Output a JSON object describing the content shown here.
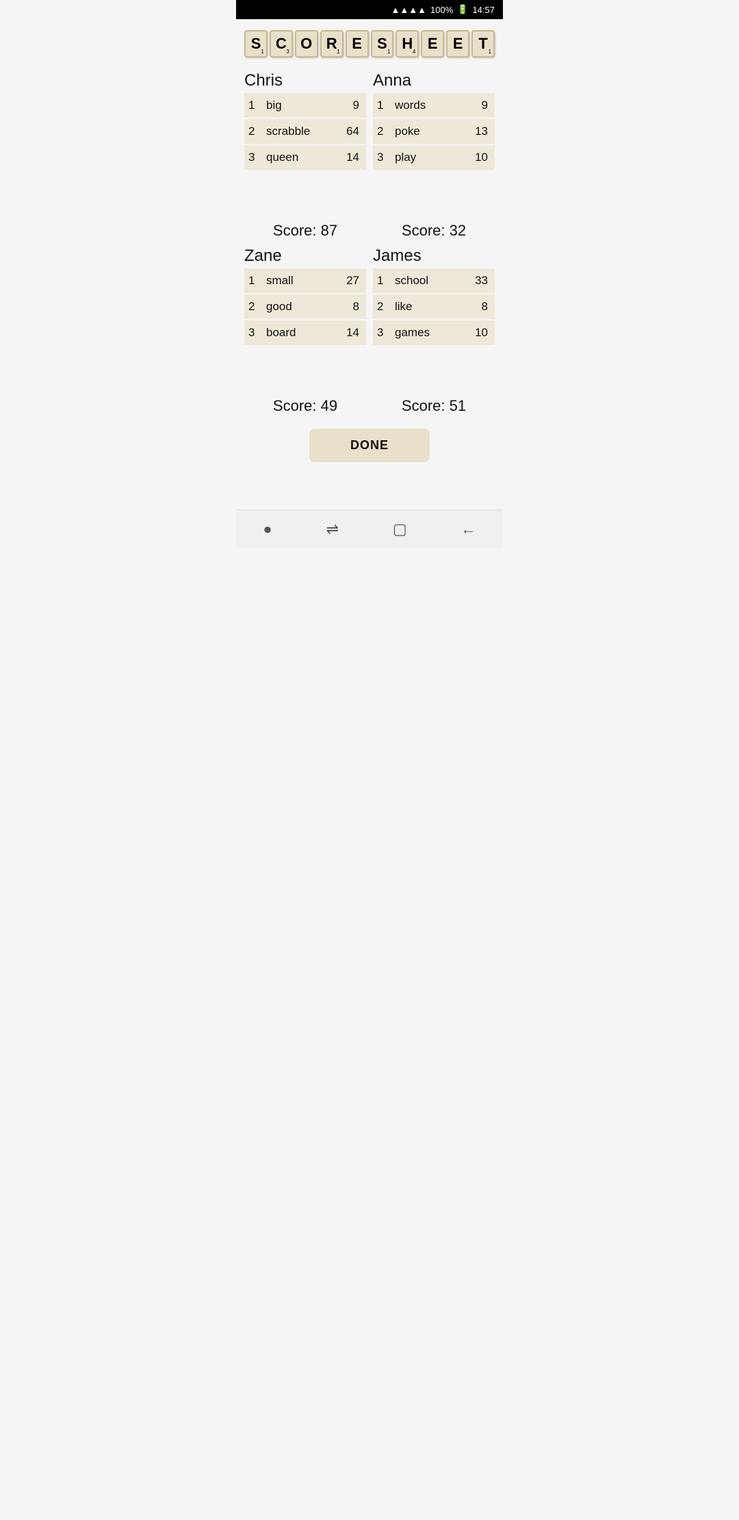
{
  "statusBar": {
    "signal": "▲▲▲▲",
    "battery": "100%",
    "time": "14:57"
  },
  "titleLetters": [
    {
      "letter": "S",
      "sub": "1"
    },
    {
      "letter": "C",
      "sub": "3"
    },
    {
      "letter": "O",
      "sub": ""
    },
    {
      "letter": "R",
      "sub": "1"
    },
    {
      "letter": "E",
      "sub": ""
    },
    {
      "letter": "S",
      "sub": "1"
    },
    {
      "letter": "H",
      "sub": "4"
    },
    {
      "letter": "E",
      "sub": ""
    },
    {
      "letter": "E",
      "sub": ""
    },
    {
      "letter": "T",
      "sub": "1"
    }
  ],
  "players": [
    {
      "name": "Chris",
      "entries": [
        {
          "num": "1",
          "word": "big",
          "points": "9"
        },
        {
          "num": "2",
          "word": "scrabble",
          "points": "64"
        },
        {
          "num": "3",
          "word": "queen",
          "points": "14"
        }
      ],
      "score": "Score: 87"
    },
    {
      "name": "Anna",
      "entries": [
        {
          "num": "1",
          "word": "words",
          "points": "9"
        },
        {
          "num": "2",
          "word": "poke",
          "points": "13"
        },
        {
          "num": "3",
          "word": "play",
          "points": "10"
        }
      ],
      "score": "Score: 32"
    },
    {
      "name": "Zane",
      "entries": [
        {
          "num": "1",
          "word": "small",
          "points": "27"
        },
        {
          "num": "2",
          "word": "good",
          "points": "8"
        },
        {
          "num": "3",
          "word": "board",
          "points": "14"
        }
      ],
      "score": "Score: 49"
    },
    {
      "name": "James",
      "entries": [
        {
          "num": "1",
          "word": "school",
          "points": "33"
        },
        {
          "num": "2",
          "word": "like",
          "points": "8"
        },
        {
          "num": "3",
          "word": "games",
          "points": "10"
        }
      ],
      "score": "Score: 51"
    }
  ],
  "doneButton": "DONE",
  "navIcons": [
    "●",
    "⇌",
    "▢",
    "←"
  ]
}
